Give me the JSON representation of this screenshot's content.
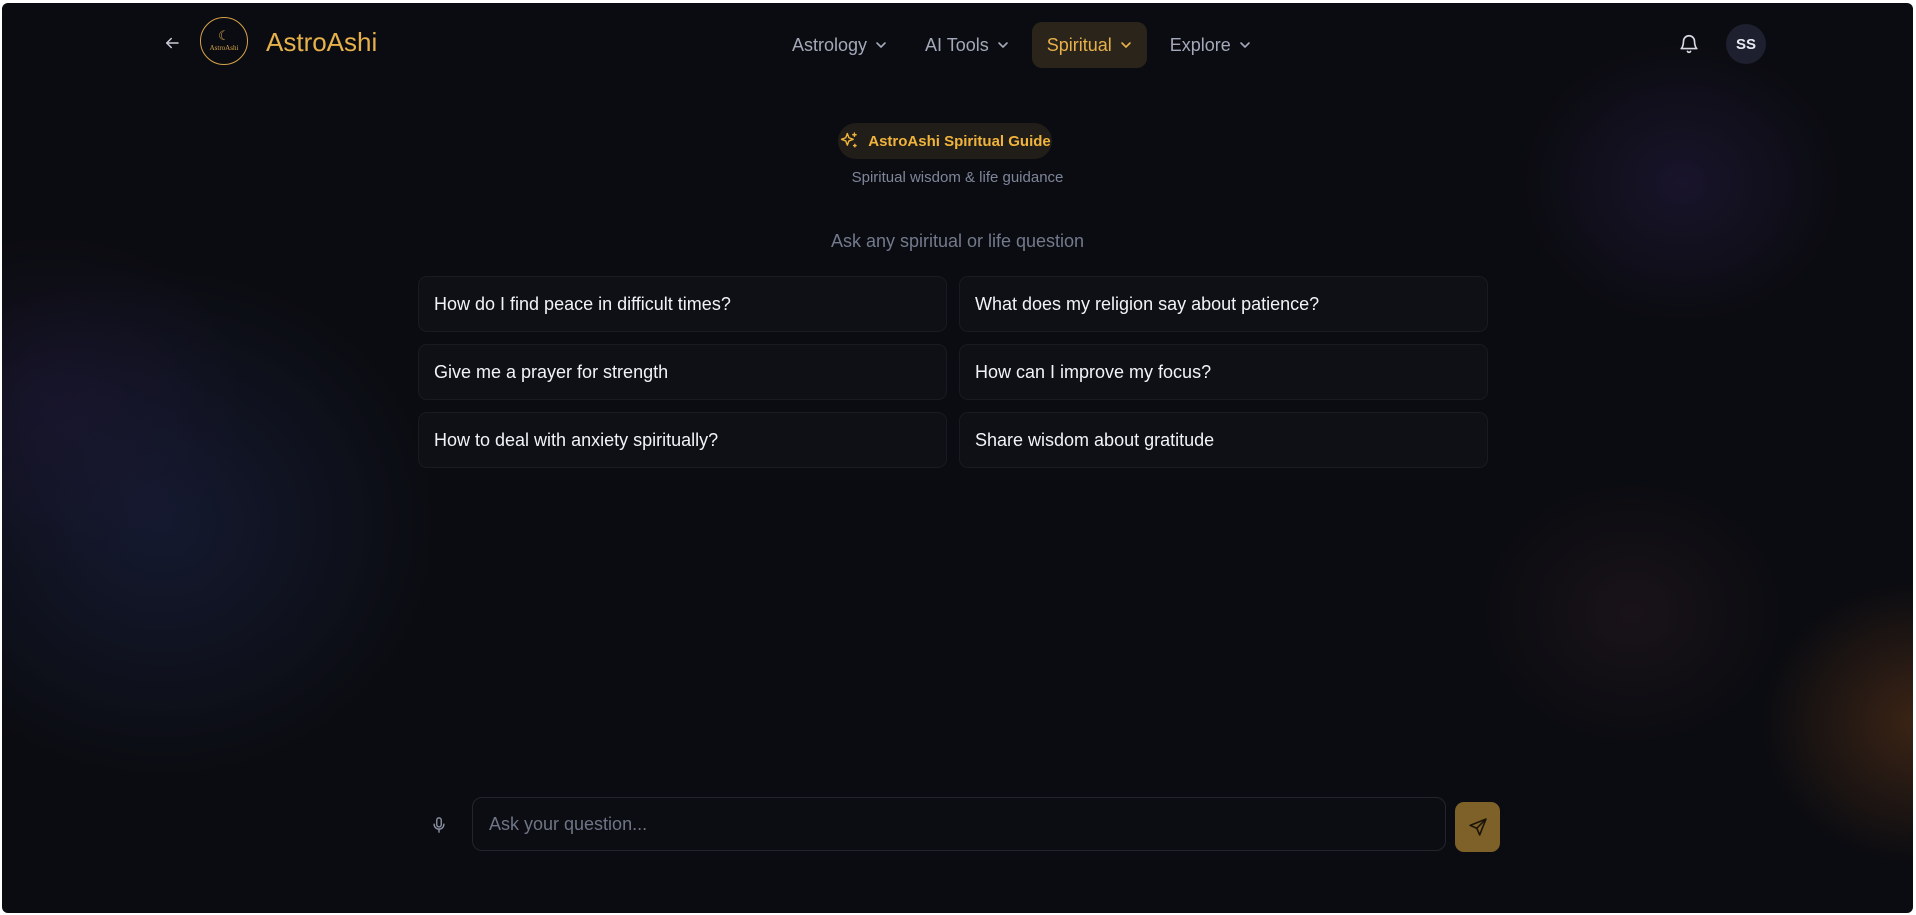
{
  "header": {
    "brand": "AstroAshi",
    "logo_text": "AstroAshi",
    "nav": [
      {
        "label": "Astrology",
        "active": false
      },
      {
        "label": "AI Tools",
        "active": false
      },
      {
        "label": "Spiritual",
        "active": true
      },
      {
        "label": "Explore",
        "active": false
      }
    ],
    "avatar_initials": "SS"
  },
  "hero": {
    "badge": "AstroAshi Spiritual Guide",
    "subtitle": "Spiritual wisdom & life guidance",
    "prompt": "Ask any spiritual or life question"
  },
  "suggestions": [
    "How do I find peace in difficult times?",
    "What does my religion say about patience?",
    "Give me a prayer for strength",
    "How can I improve my focus?",
    "How to deal with anxiety spiritually?",
    "Share wisdom about gratitude"
  ],
  "input": {
    "placeholder": "Ask your question...",
    "value": ""
  },
  "icons": {
    "back": "arrow-left-icon",
    "nav_chevron": "chevron-down-icon",
    "notifications": "bell-icon",
    "badge": "sparkles-icon",
    "mic": "microphone-icon",
    "send": "send-icon"
  },
  "colors": {
    "background": "#0b0c11",
    "accent": "#e6b04a",
    "active_nav_bg": "#2a241a",
    "send_button": "#7d6128"
  }
}
